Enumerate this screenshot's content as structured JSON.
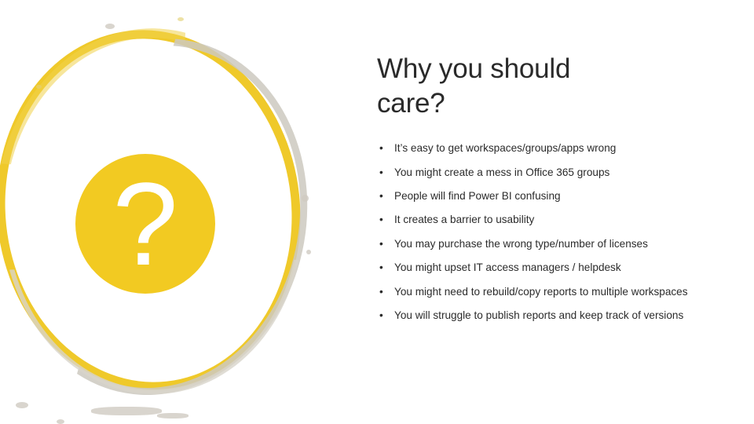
{
  "slide": {
    "title": "Why you should care?",
    "decoration": {
      "question_mark_glyph": "?",
      "accent_color": "#f2ca22",
      "ring_color": "#efc92a",
      "smudge_color": "#cdc9c0"
    },
    "bullet_marker": "•",
    "bullets": [
      "It’s easy to get workspaces/groups/apps wrong",
      "You might create a mess in Office 365 groups",
      "People will find Power BI confusing",
      "It creates a barrier to usability",
      "You may purchase the wrong type/number of licenses",
      "You might upset IT access managers / helpdesk",
      "You might need to rebuild/copy reports to multiple workspaces",
      "You will struggle to publish reports and keep track of versions"
    ]
  }
}
